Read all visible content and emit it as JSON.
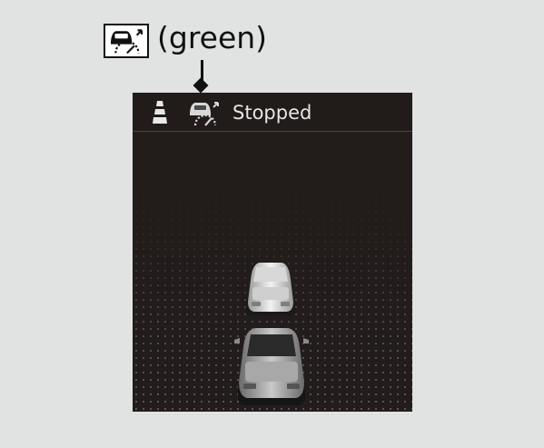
{
  "legend": {
    "icon": "traffic-jam-assist-icon",
    "label": "(green)",
    "icon_color": "#111111"
  },
  "display": {
    "status_text": "Stopped",
    "lane_icon": "lane-keeping-icon",
    "traffic_icon": "traffic-jam-assist-icon",
    "background_color": "#221d1c",
    "text_color": "#e6e6e6"
  },
  "vehicles": [
    {
      "name": "vehicle-ahead",
      "icon": "car-icon"
    },
    {
      "name": "own-vehicle",
      "icon": "car-icon"
    }
  ]
}
